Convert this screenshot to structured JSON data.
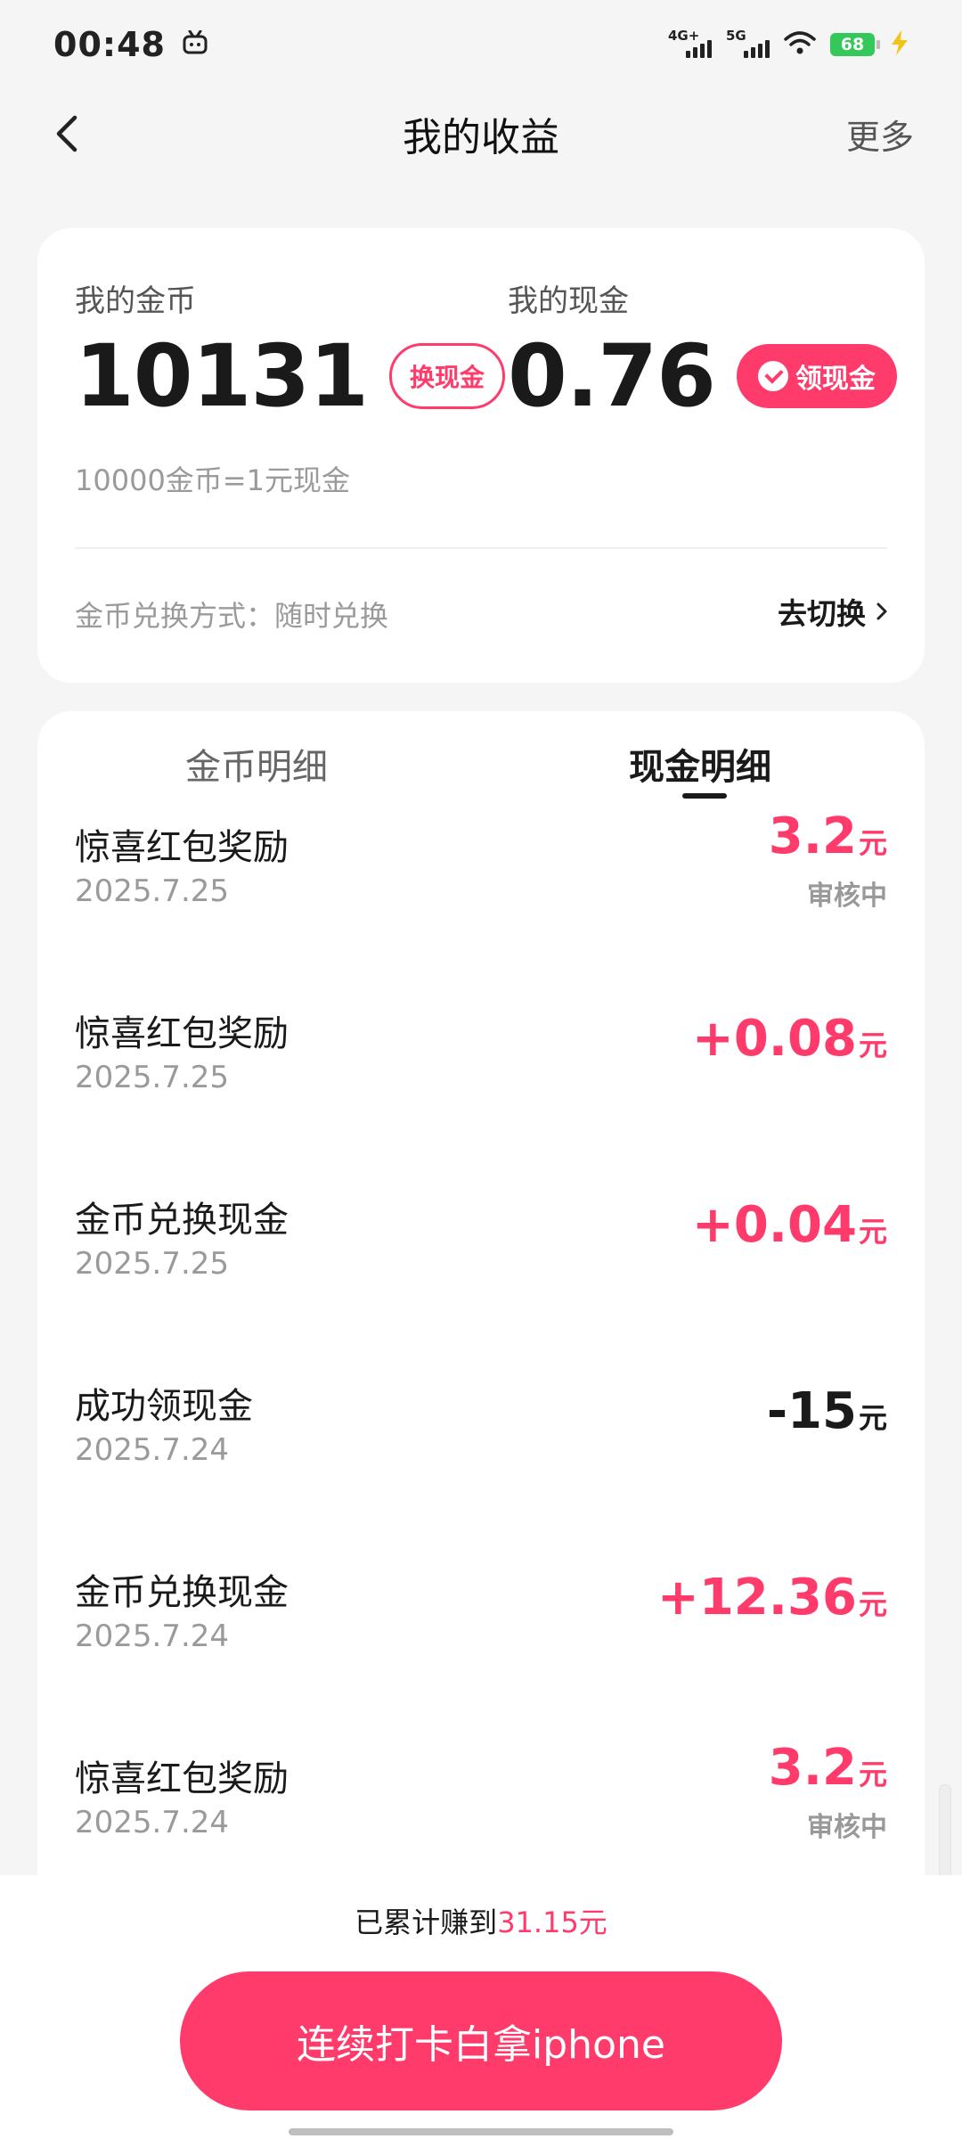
{
  "status_bar": {
    "time": "00:48",
    "net1": "4G+",
    "net2": "5G",
    "battery": "68"
  },
  "nav": {
    "title": "我的收益",
    "more": "更多"
  },
  "earnings": {
    "coin_label": "我的金币",
    "coin_value": "10131",
    "coin_button": "换现金",
    "cash_label": "我的现金",
    "cash_value": "0.76",
    "cash_button": "领现金",
    "rate": "10000金币=1元现金",
    "method": "金币兑换方式：随时兑换",
    "switch": "去切换"
  },
  "tabs": {
    "coin": "金币明细",
    "cash": "现金明细",
    "active": "cash"
  },
  "records": [
    {
      "name": "惊喜红包奖励",
      "date": "2025.7.25",
      "amount": "3.2",
      "unit": "元",
      "status": "审核中",
      "type": "pos"
    },
    {
      "name": "惊喜红包奖励",
      "date": "2025.7.25",
      "amount": "+0.08",
      "unit": "元",
      "status": "",
      "type": "pos"
    },
    {
      "name": "金币兑换现金",
      "date": "2025.7.25",
      "amount": "+0.04",
      "unit": "元",
      "status": "",
      "type": "pos"
    },
    {
      "name": "成功领现金",
      "date": "2025.7.24",
      "amount": "-15",
      "unit": "元",
      "status": "",
      "type": "neg"
    },
    {
      "name": "金币兑换现金",
      "date": "2025.7.24",
      "amount": "+12.36",
      "unit": "元",
      "status": "",
      "type": "pos"
    },
    {
      "name": "惊喜红包奖励",
      "date": "2025.7.24",
      "amount": "3.2",
      "unit": "元",
      "status": "审核中",
      "type": "pos"
    }
  ],
  "bottom": {
    "total_prefix": "已累计赚到",
    "total_value": "31.15元",
    "cta": "连续打卡白拿iphone"
  },
  "colors": {
    "accent": "#ff3b6b",
    "background": "#f5f5f5",
    "battery": "#34c759"
  }
}
